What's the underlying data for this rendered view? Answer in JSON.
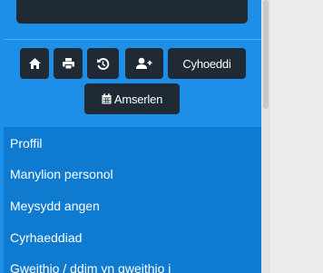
{
  "toolbar": {
    "icons": [
      "home-icon",
      "print-icon",
      "history-icon",
      "add-user-icon"
    ],
    "publish_label": "Cyhoeddi",
    "schedule_icon": "calendar-icon",
    "schedule_label": "Amserlen"
  },
  "nav": {
    "items": [
      {
        "label": "Proffil"
      },
      {
        "label": "Manylion personol"
      },
      {
        "label": "Meysydd angen"
      },
      {
        "label": "Cyrhaeddiad"
      },
      {
        "label": "Gweithio / ddim yn gweithio i"
      }
    ]
  },
  "colors": {
    "sidebar": "#1e8fe8",
    "nav_background": "#0e7bd0",
    "button": "#1f2a35"
  }
}
